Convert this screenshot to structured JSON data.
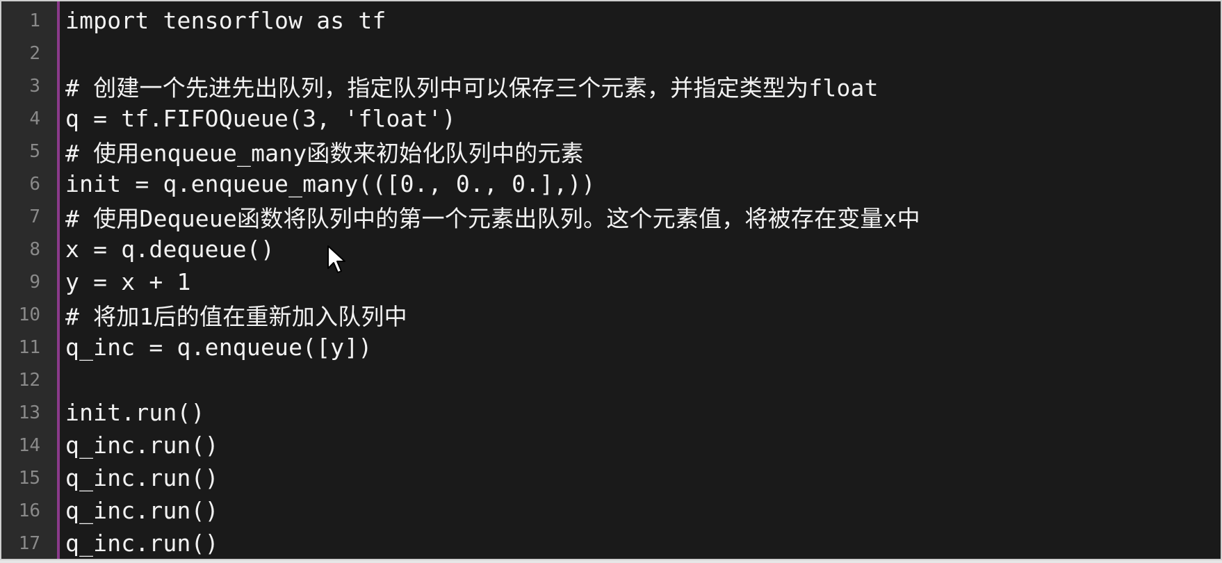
{
  "editor": {
    "lines": [
      {
        "num": "1",
        "text": "import tensorflow as tf"
      },
      {
        "num": "2",
        "text": ""
      },
      {
        "num": "3",
        "text": "# 创建一个先进先出队列，指定队列中可以保存三个元素，并指定类型为float"
      },
      {
        "num": "4",
        "text": "q = tf.FIFOQueue(3, 'float')"
      },
      {
        "num": "5",
        "text": "# 使用enqueue_many函数来初始化队列中的元素"
      },
      {
        "num": "6",
        "text": "init = q.enqueue_many(([0., 0., 0.],))"
      },
      {
        "num": "7",
        "text": "# 使用Dequeue函数将队列中的第一个元素出队列。这个元素值，将被存在变量x中"
      },
      {
        "num": "8",
        "text": "x = q.dequeue()"
      },
      {
        "num": "9",
        "text": "y = x + 1"
      },
      {
        "num": "10",
        "text": "# 将加1后的值在重新加入队列中"
      },
      {
        "num": "11",
        "text": "q_inc = q.enqueue([y])"
      },
      {
        "num": "12",
        "text": ""
      },
      {
        "num": "13",
        "text": "init.run()"
      },
      {
        "num": "14",
        "text": "q_inc.run()"
      },
      {
        "num": "15",
        "text": "q_inc.run()"
      },
      {
        "num": "16",
        "text": "q_inc.run()"
      },
      {
        "num": "17",
        "text": "q_inc.run()"
      }
    ]
  },
  "icons": {
    "cursor": "mouse-pointer-icon"
  },
  "colors": {
    "background": "#1a1a1a",
    "gutter": "#2b2b2b",
    "gutter_border": "#8a3a8a",
    "text": "#f2f2f2",
    "line_number": "#8a8a8a"
  }
}
